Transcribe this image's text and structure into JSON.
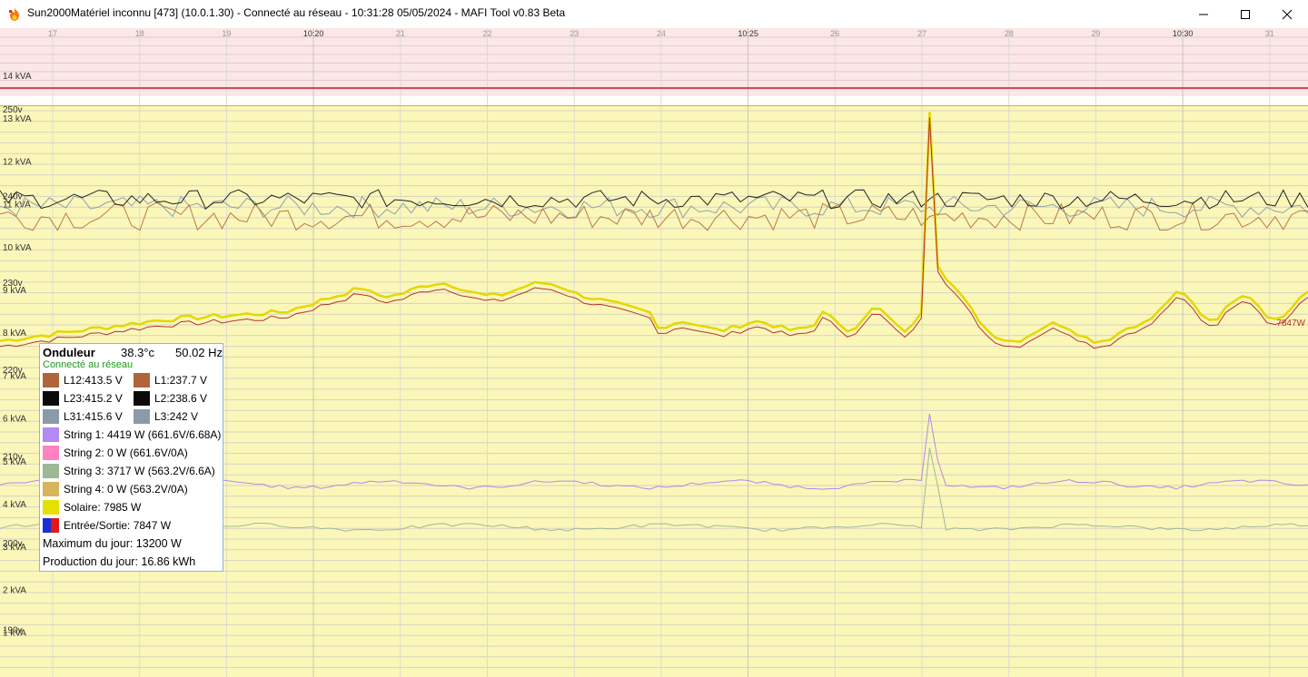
{
  "window": {
    "title": "Sun2000Matériel inconnu [473] (10.0.1.30) - Connecté au réseau - 10:31:28 05/05/2024 - MAFI Tool v0.83 Beta",
    "icon": "app-flame-icon",
    "buttons": [
      "minimize-icon",
      "maximize-icon",
      "close-icon"
    ]
  },
  "colors": {
    "bg_top": "#fbe7e8",
    "bg_plot": "#fbf7b9",
    "grid": "#d6d3c2",
    "max_line": "#c0202a",
    "solar": "#e3d800",
    "grid_io": "#b83030",
    "l12": "#b87a4a",
    "l23": "#222222",
    "l31": "#8ea0b2",
    "string1": "#b18ae6",
    "string3": "#9fb89a"
  },
  "axis": {
    "time_ticks": [
      {
        "label": "17",
        "major": false
      },
      {
        "label": "18",
        "major": false
      },
      {
        "label": "19",
        "major": false
      },
      {
        "label": "10:20",
        "major": true
      },
      {
        "label": "21",
        "major": false
      },
      {
        "label": "22",
        "major": false
      },
      {
        "label": "23",
        "major": false
      },
      {
        "label": "24",
        "major": false
      },
      {
        "label": "10:25",
        "major": true
      },
      {
        "label": "26",
        "major": false
      },
      {
        "label": "27",
        "major": false
      },
      {
        "label": "28",
        "major": false
      },
      {
        "label": "29",
        "major": false
      },
      {
        "label": "10:30",
        "major": true
      },
      {
        "label": "31",
        "major": false
      }
    ],
    "kva_labels": [
      {
        "v": 14,
        "label": "14 kVA"
      },
      {
        "v": 13,
        "label": "13 kVA"
      },
      {
        "v": 12,
        "label": "12 kVA"
      },
      {
        "v": 11,
        "label": "11 kVA"
      },
      {
        "v": 10,
        "label": "10 kVA"
      },
      {
        "v": 9,
        "label": "9 kVA"
      },
      {
        "v": 8,
        "label": "8 kVA"
      },
      {
        "v": 7,
        "label": "7 kVA"
      },
      {
        "v": 6,
        "label": "6 kVA"
      },
      {
        "v": 5,
        "label": "5 kVA"
      },
      {
        "v": 4,
        "label": "4 kVA"
      },
      {
        "v": 3,
        "label": "3 kVA"
      },
      {
        "v": 2,
        "label": "2 kVA"
      },
      {
        "v": 1,
        "label": "1 kVA"
      }
    ],
    "volt_labels": [
      {
        "v": 250,
        "label": "250v"
      },
      {
        "v": 240,
        "label": "240v"
      },
      {
        "v": 230,
        "label": "230v"
      },
      {
        "v": 220,
        "label": "220v"
      },
      {
        "v": 210,
        "label": "210v"
      },
      {
        "v": 200,
        "label": "200v"
      },
      {
        "v": 190,
        "label": "190v"
      }
    ],
    "max_day_kw": 13.2,
    "end_label": "7847W"
  },
  "legend": {
    "title": "Onduleur",
    "temp": "38.3°c",
    "freq": "50.02 Hz",
    "status": "Connecté au réseau",
    "phases": [
      {
        "label": "L12:413.5 V",
        "color": "#b0643a"
      },
      {
        "label": "L1:237.7 V",
        "color": "#b0643a"
      },
      {
        "label": "L23:415.2 V",
        "color": "#0a0a0a"
      },
      {
        "label": "L2:238.6 V",
        "color": "#0a0a0a"
      },
      {
        "label": "L31:415.6 V",
        "color": "#8a9aaa"
      },
      {
        "label": "L3:242 V",
        "color": "#8a9aaa"
      }
    ],
    "strings": [
      {
        "label": "String 1: 4419 W (661.6V/6.68A)",
        "color": "#b389f2"
      },
      {
        "label": "String 2: 0 W (661.6V/0A)",
        "color": "#ff82c0"
      },
      {
        "label": "String 3: 3717 W (563.2V/6.6A)",
        "color": "#9cb894"
      },
      {
        "label": "String 4: 0 W (563.2V/0A)",
        "color": "#d8b45a"
      }
    ],
    "solar": {
      "label": "Solaire: 7985 W",
      "color": "#e6e000"
    },
    "io": {
      "label": "Entrée/Sortie: 7847 W"
    },
    "max_day": "Maximum du jour: 13200 W",
    "production": "Production du jour: 16.86 kWh"
  }
}
